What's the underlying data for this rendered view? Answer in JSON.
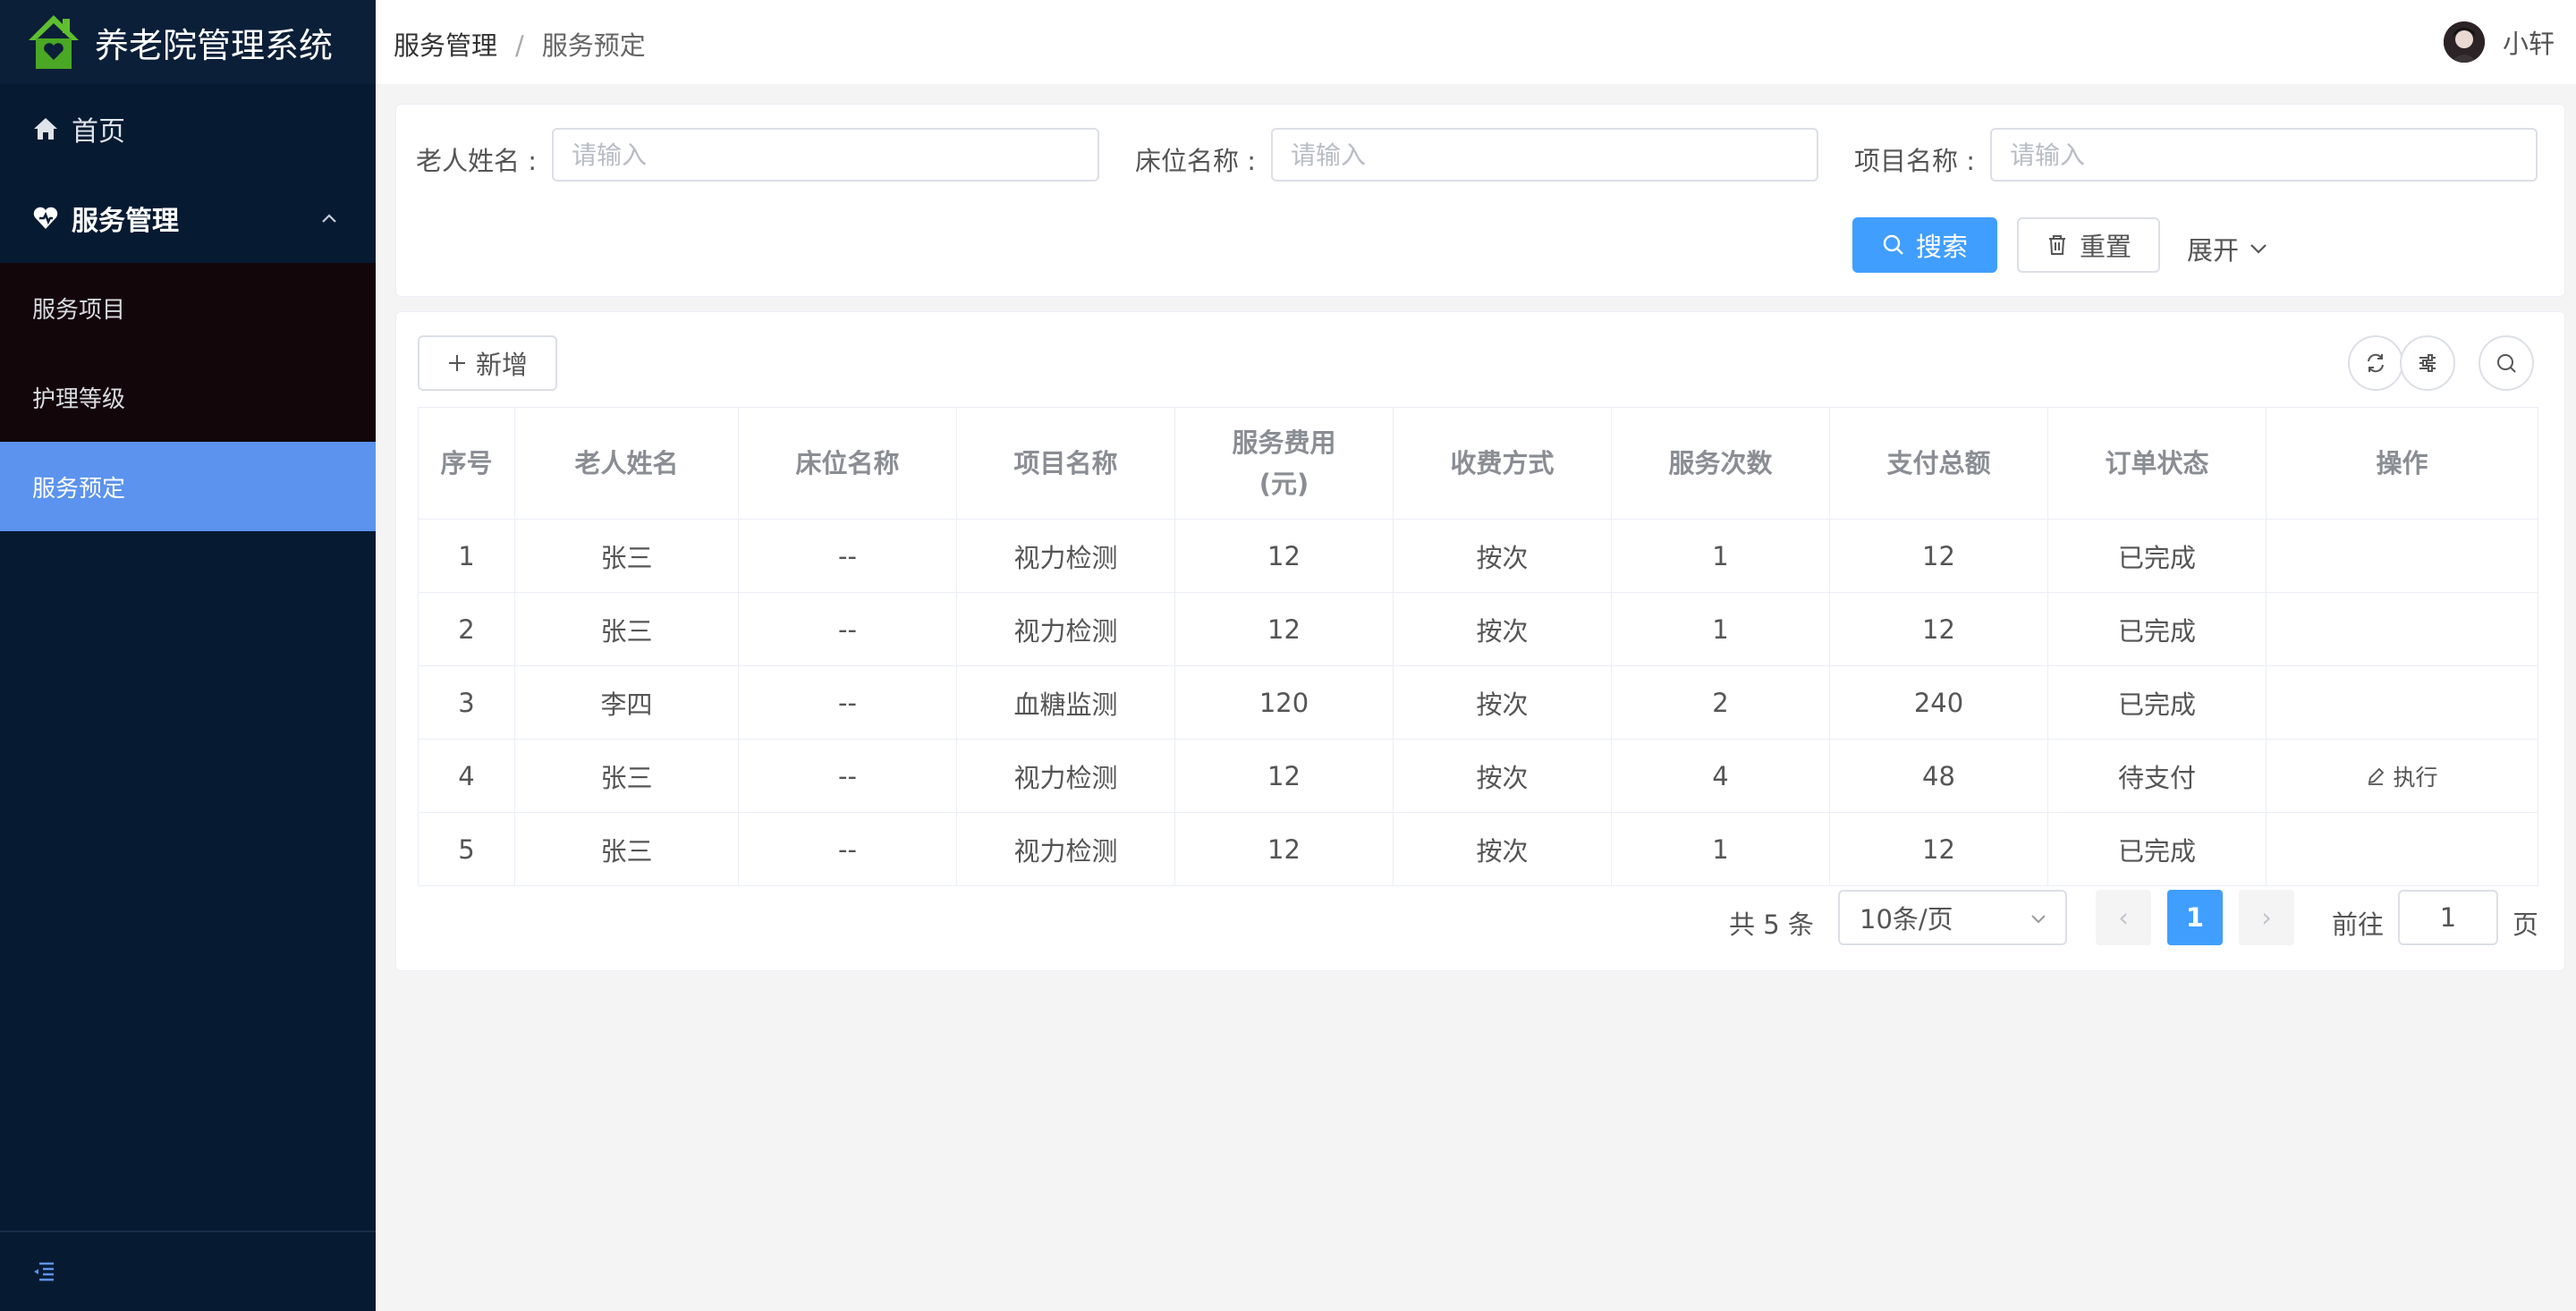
{
  "app": {
    "title": "养老院管理系统"
  },
  "colors": {
    "sidebar": "#061a32",
    "accent": "#409eff",
    "active_menu": "#5b93ee"
  },
  "sidebar": {
    "home_label": "首页",
    "group_label": "服务管理",
    "items": [
      {
        "label": "服务项目",
        "active": false
      },
      {
        "label": "护理等级",
        "active": false
      },
      {
        "label": "服务预定",
        "active": true
      }
    ]
  },
  "breadcrumb": {
    "parent": "服务管理",
    "separator": "/",
    "current": "服务预定"
  },
  "user": {
    "name": "小轩"
  },
  "search": {
    "elder_name_label": "老人姓名 :",
    "elder_name_placeholder": "请输入",
    "bed_name_label": "床位名称 :",
    "bed_name_placeholder": "请输入",
    "project_name_label": "项目名称 :",
    "project_name_placeholder": "请输入",
    "search_button": "搜索",
    "reset_button": "重置",
    "expand_label": "展开"
  },
  "toolbar": {
    "add_button": "新增"
  },
  "table": {
    "headers": [
      "序号",
      "老人姓名",
      "床位名称",
      "项目名称",
      "服务费用",
      "(元)",
      "收费方式",
      "服务次数",
      "支付总额",
      "订单状态",
      "操作"
    ],
    "rows": [
      {
        "index": "1",
        "elder": "张三",
        "bed": "--",
        "project": "视力检测",
        "fee": "12",
        "method": "按次",
        "count": "1",
        "total": "12",
        "status": "已完成",
        "action": ""
      },
      {
        "index": "2",
        "elder": "张三",
        "bed": "--",
        "project": "视力检测",
        "fee": "12",
        "method": "按次",
        "count": "1",
        "total": "12",
        "status": "已完成",
        "action": ""
      },
      {
        "index": "3",
        "elder": "李四",
        "bed": "--",
        "project": "血糖监测",
        "fee": "120",
        "method": "按次",
        "count": "2",
        "total": "240",
        "status": "已完成",
        "action": ""
      },
      {
        "index": "4",
        "elder": "张三",
        "bed": "--",
        "project": "视力检测",
        "fee": "12",
        "method": "按次",
        "count": "4",
        "total": "48",
        "status": "待支付",
        "action": "执行"
      },
      {
        "index": "5",
        "elder": "张三",
        "bed": "--",
        "project": "视力检测",
        "fee": "12",
        "method": "按次",
        "count": "1",
        "total": "12",
        "status": "已完成",
        "action": ""
      }
    ]
  },
  "pagination": {
    "total_text": "共 5 条",
    "page_size": "10条/页",
    "prev": "‹",
    "current_page": "1",
    "next": "›",
    "goto_label": "前往",
    "goto_value": "1",
    "page_suffix": "页"
  }
}
